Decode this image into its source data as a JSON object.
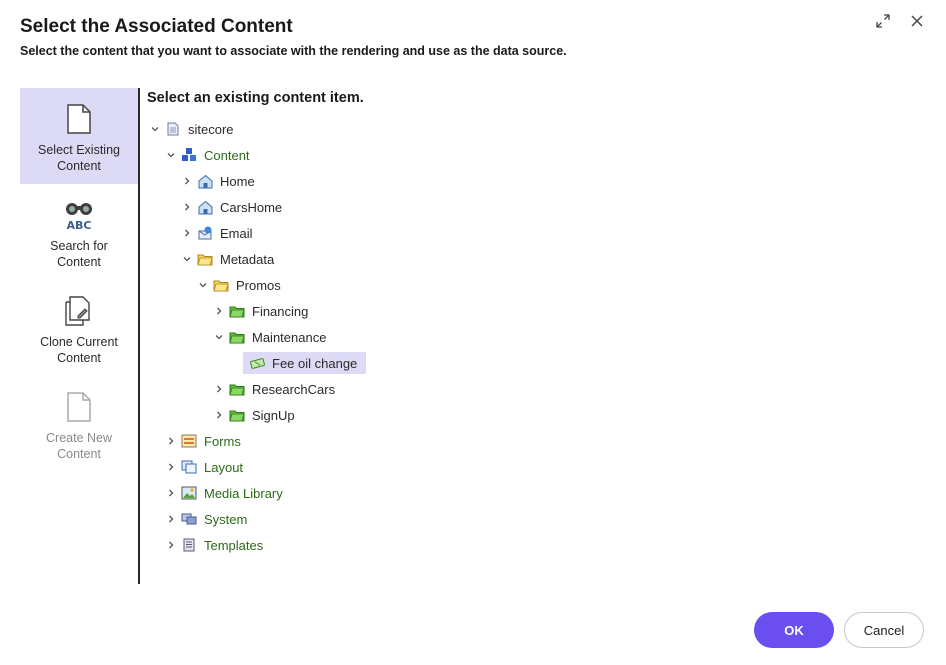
{
  "dialog": {
    "title": "Select the Associated Content",
    "subtitle": "Select the content that you want to associate with the rendering and use as the data source."
  },
  "sidebar": {
    "items": [
      {
        "label": "Select Existing Content",
        "icon": "document-icon",
        "active": true
      },
      {
        "label": "Search for Content",
        "icon": "binoculars-abc-icon",
        "active": false
      },
      {
        "label": "Clone Current Content",
        "icon": "document-clone-icon",
        "active": false
      },
      {
        "label": "Create New Content",
        "icon": "document-new-icon",
        "disabled": true
      }
    ]
  },
  "tree": {
    "heading": "Select an existing content item.",
    "nodes": [
      {
        "label": "sitecore",
        "icon": "page-icon",
        "expanded": true
      },
      {
        "label": "Content",
        "icon": "content-cubes-icon",
        "expanded": true
      },
      {
        "label": "Home",
        "icon": "home-icon",
        "expanded": false
      },
      {
        "label": "CarsHome",
        "icon": "home-icon",
        "expanded": false
      },
      {
        "label": "Email",
        "icon": "email-icon",
        "expanded": false
      },
      {
        "label": "Metadata",
        "icon": "folder-icon",
        "expanded": true
      },
      {
        "label": "Promos",
        "icon": "folder-icon",
        "expanded": true
      },
      {
        "label": "Financing",
        "icon": "green-folder-icon",
        "expanded": false
      },
      {
        "label": "Maintenance",
        "icon": "green-folder-icon",
        "expanded": true
      },
      {
        "label": "Fee oil change",
        "icon": "ticket-icon",
        "selected": true
      },
      {
        "label": "ResearchCars",
        "icon": "green-folder-icon",
        "expanded": false
      },
      {
        "label": "SignUp",
        "icon": "green-folder-icon",
        "expanded": false
      },
      {
        "label": "Forms",
        "icon": "forms-icon",
        "expanded": false
      },
      {
        "label": "Layout",
        "icon": "layout-icon",
        "expanded": false
      },
      {
        "label": "Media Library",
        "icon": "media-icon",
        "expanded": false
      },
      {
        "label": "System",
        "icon": "system-icon",
        "expanded": false
      },
      {
        "label": "Templates",
        "icon": "templates-icon",
        "expanded": false
      }
    ]
  },
  "buttons": {
    "ok": "OK",
    "cancel": "Cancel"
  },
  "colors": {
    "accent": "#6b4ef0",
    "selection": "#dcdaf5",
    "green_text": "#2b6b1a"
  }
}
